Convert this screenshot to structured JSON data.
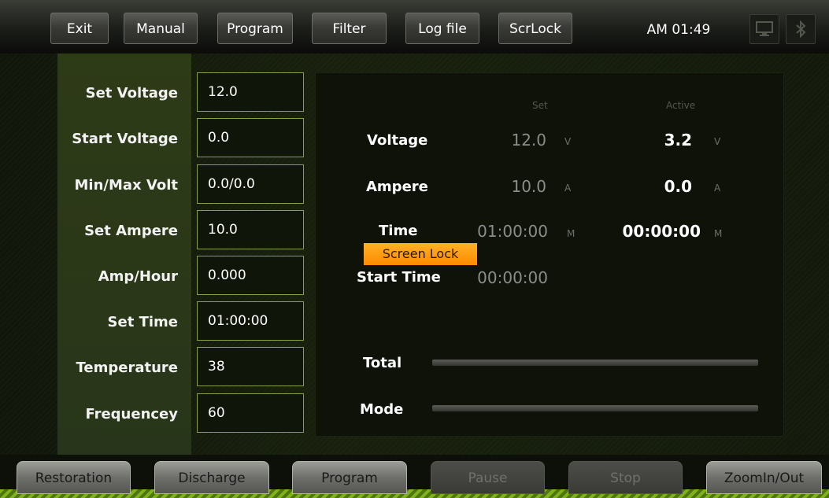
{
  "toolbar": {
    "exit": "Exit",
    "manual": "Manual",
    "program": "Program",
    "filter": "Filter",
    "log_file": "Log file",
    "scrlock": "ScrLock",
    "clock": "AM 01:49"
  },
  "settings": [
    {
      "label": "Set Voltage",
      "value": "12.0"
    },
    {
      "label": "Start Voltage",
      "value": "0.0"
    },
    {
      "label": "Min/Max Volt",
      "value": "0.0/0.0"
    },
    {
      "label": "Set Ampere",
      "value": "10.0"
    },
    {
      "label": "Amp/Hour",
      "value": "0.000"
    },
    {
      "label": "Set Time",
      "value": "01:00:00"
    },
    {
      "label": "Temperature",
      "value": "38"
    },
    {
      "label": "Frequencey",
      "value": "60"
    }
  ],
  "readout": {
    "header_set": "Set",
    "header_active": "Active",
    "voltage": {
      "label": "Voltage",
      "set": "12.0",
      "active": "3.2",
      "unit": "V"
    },
    "ampere": {
      "label": "Ampere",
      "set": "10.0",
      "active": "0.0",
      "unit": "A"
    },
    "time": {
      "label": "Time",
      "set": "01:00:00",
      "active": "00:00:00",
      "unit": "M"
    },
    "start_time": {
      "label": "Start Time",
      "set": "00:00:00"
    },
    "total_label": "Total",
    "mode_label": "Mode",
    "screen_lock_badge": "Screen Lock"
  },
  "bottom": {
    "restoration": "Restoration",
    "discharge": "Discharge",
    "program": "Program",
    "pause": "Pause",
    "stop": "Stop",
    "zoom": "ZoomIn/Out"
  },
  "colors": {
    "accent_green": "#8aa044",
    "lock_orange": "#ff9a10",
    "stripe_green": "#7fb21d"
  }
}
